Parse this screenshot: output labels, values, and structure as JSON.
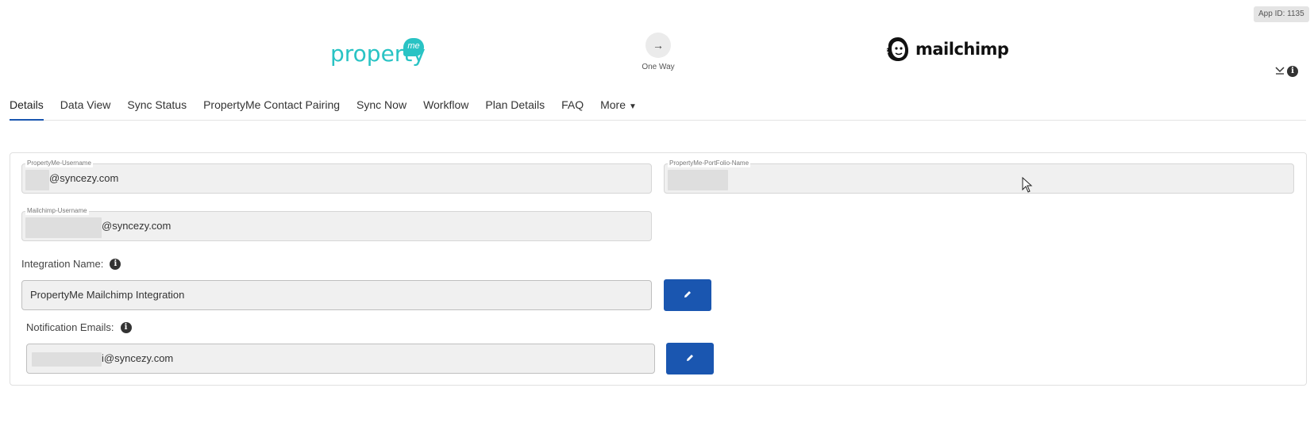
{
  "app_id": "App ID: 1135",
  "logos": {
    "source": {
      "word": "property",
      "badge": "me"
    },
    "target": {
      "word": "mailchimp"
    }
  },
  "sync": {
    "arrow": "→",
    "label": "One Way"
  },
  "tabs": [
    {
      "label": "Details",
      "active": true
    },
    {
      "label": "Data View"
    },
    {
      "label": "Sync Status"
    },
    {
      "label": "PropertyMe Contact Pairing"
    },
    {
      "label": "Sync Now"
    },
    {
      "label": "Workflow"
    },
    {
      "label": "Plan Details"
    },
    {
      "label": "FAQ"
    },
    {
      "label": "More"
    }
  ],
  "fields": {
    "pm_username": {
      "label": "PropertyMe-Username",
      "value": "@syncezy.com"
    },
    "pm_portfolio": {
      "label": "PropertyMe-PortFolio-Name",
      "value": ""
    },
    "mc_username": {
      "label": "Mailchimp-Username",
      "value": "@syncezy.com"
    }
  },
  "integration_name": {
    "label": "Integration Name:",
    "value": "PropertyMe Mailchimp Integration"
  },
  "notification_emails": {
    "label": "Notification Emails:",
    "value": "i@syncezy.com"
  },
  "colors": {
    "accent": "#1a56b0",
    "brand_teal": "#29c3c4"
  },
  "icons": {
    "collapse": "chevron-down-icon",
    "info": "info-icon",
    "edit": "pencil-icon"
  }
}
